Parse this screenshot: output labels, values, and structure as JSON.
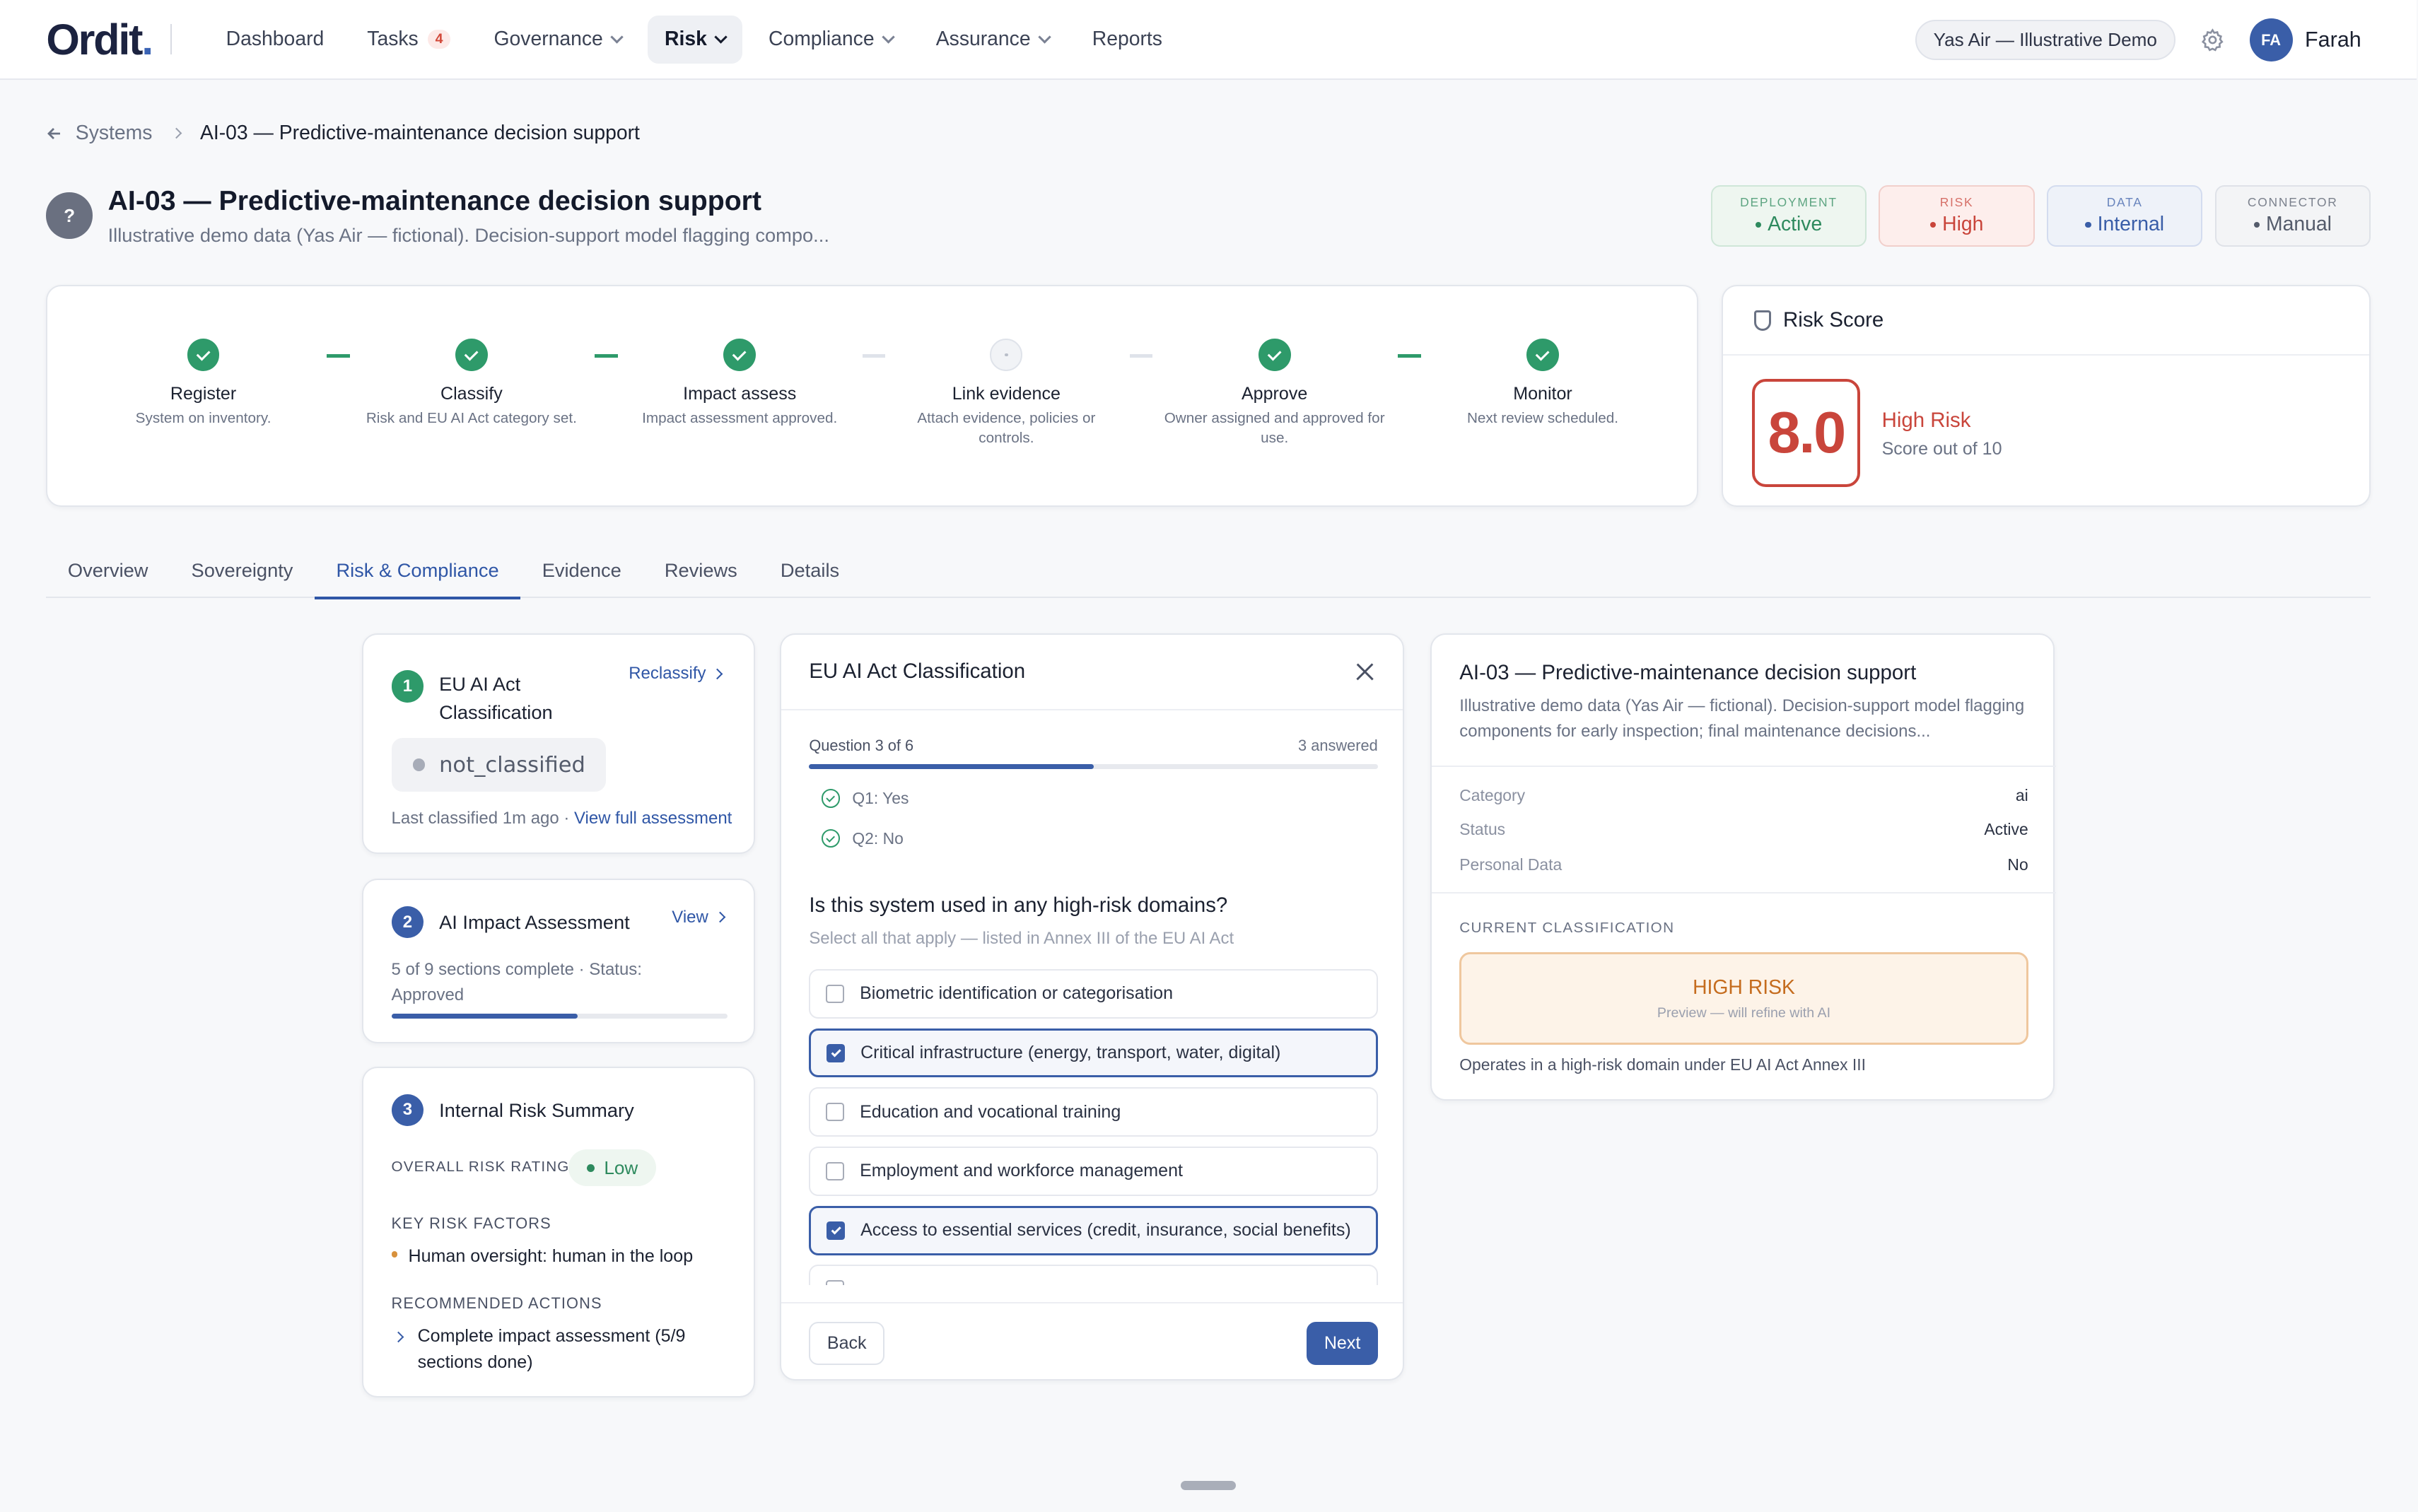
{
  "nav": {
    "logo": "Ordit",
    "logo_dot": ".",
    "items": [
      {
        "label": "Dashboard"
      },
      {
        "label": "Tasks",
        "badge": "4"
      },
      {
        "label": "Governance"
      },
      {
        "label": "Risk"
      },
      {
        "label": "Compliance"
      },
      {
        "label": "Assurance"
      },
      {
        "label": "Reports"
      }
    ],
    "org": "Yas Air — Illustrative Demo",
    "avatar_initials": "FA",
    "user_name": "Farah"
  },
  "breadcrumb": {
    "parent": "Systems",
    "current": "AI-03 — Predictive-maintenance decision support"
  },
  "system": {
    "icon": "?",
    "title": "AI-03 — Predictive-maintenance decision support",
    "subtitle": "Illustrative demo data (Yas Air — fictional). Decision-support model flagging compo..."
  },
  "chips": [
    {
      "label": "Deployment",
      "value": "Active",
      "color": "#2e8a5e",
      "bg": "#eef6f0",
      "border": "#cfe6d8"
    },
    {
      "label": "Risk",
      "value": "High",
      "color": "#c9453b",
      "bg": "#fdeeec",
      "border": "#f1cfcb"
    },
    {
      "label": "Data",
      "value": "Internal",
      "color": "#3a5ea8",
      "bg": "#eef2f9",
      "border": "#d3dcef"
    },
    {
      "label": "Connector",
      "value": "Manual",
      "color": "#545b6b",
      "bg": "#f3f4f6",
      "border": "#dfe2e8"
    }
  ],
  "steps": [
    {
      "name": "Register",
      "desc": "System on inventory.",
      "done": true
    },
    {
      "name": "Classify",
      "desc": "Risk and EU AI Act category set.",
      "done": true
    },
    {
      "name": "Impact assess",
      "desc": "Impact assessment approved.",
      "done": true
    },
    {
      "name": "Link evidence",
      "desc": "Attach evidence, policies or controls.",
      "done": false
    },
    {
      "name": "Approve",
      "desc": "Owner assigned and approved for use.",
      "done": true
    },
    {
      "name": "Monitor",
      "desc": "Next review scheduled.",
      "done": true
    }
  ],
  "risk_score": {
    "title": "Risk Score",
    "value": "8.0",
    "label": "High Risk",
    "sub": "Score out of 10"
  },
  "tabs": [
    "Overview",
    "Sovereignty",
    "Risk & Compliance",
    "Evidence",
    "Reviews",
    "Details"
  ],
  "active_tab": "Risk & Compliance",
  "left": {
    "c1": {
      "num": "1",
      "title": "EU AI Act Classification",
      "link": "Reclassify",
      "status": "not_classified",
      "last": "Last classified 1m ago · ",
      "last_link": "View full assessment"
    },
    "c2": {
      "num": "2",
      "title": "AI Impact Assessment",
      "link": "View",
      "desc": "5 of 9 sections complete · Status: Approved",
      "progress": 0.555
    },
    "c3": {
      "num": "3",
      "title": "Internal Risk Summary",
      "rating_label": "Overall risk rating",
      "rating": "Low",
      "factors_label": "Key risk factors",
      "factor": "Human oversight: human in the loop",
      "actions_label": "Recommended actions",
      "action": "Complete impact assessment (5/9 sections done)"
    }
  },
  "modal": {
    "title": "EU AI Act Classification",
    "question_of": "Question 3 of 6",
    "answered": "3 answered",
    "progress": 0.5,
    "previous": [
      "Q1: Yes",
      "Q2: No"
    ],
    "question": "Is this system used in any high-risk domains?",
    "hint": "Select all that apply — listed in Annex III of the EU AI Act",
    "options": [
      {
        "label": "Biometric identification or categorisation",
        "selected": false
      },
      {
        "label": "Critical infrastructure (energy, transport, water, digital)",
        "selected": true
      },
      {
        "label": "Education and vocational training",
        "selected": false
      },
      {
        "label": "Employment and workforce management",
        "selected": false
      },
      {
        "label": "Access to essential services (credit, insurance, social benefits)",
        "selected": true
      },
      {
        "label": "",
        "selected": false
      }
    ],
    "back": "Back",
    "next": "Next"
  },
  "detail": {
    "title": "AI-03 — Predictive-maintenance decision support",
    "desc": "Illustrative demo data (Yas Air — fictional). Decision-support model flagging components for early inspection; final maintenance decisions...",
    "rows": [
      {
        "k": "Category",
        "v": "ai"
      },
      {
        "k": "Status",
        "v": "Active"
      },
      {
        "k": "Personal Data",
        "v": "No"
      }
    ],
    "current_label": "Current classification",
    "class_title": "HIGH RISK",
    "class_sub": "Preview — will refine with AI",
    "footnote": "Operates in a high-risk domain under EU AI Act Annex III"
  }
}
